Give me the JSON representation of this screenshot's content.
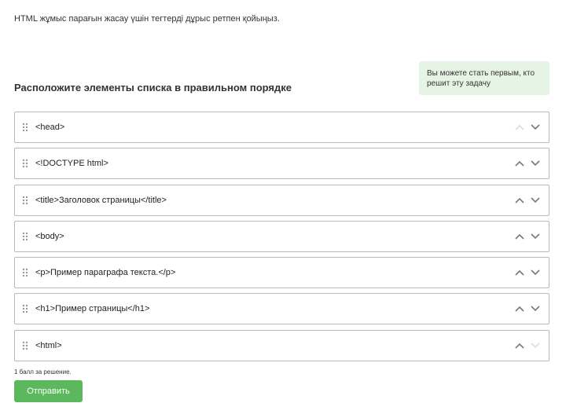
{
  "instruction": "HTML жұмыс парағын жасау үшін тегтерді дұрыс ретпен қойыңыз.",
  "hint": "Вы можете стать первым, кто решит эту задачу",
  "task_title": "Расположите элементы списка в правильном порядке",
  "items": [
    {
      "label": "<head>",
      "up_enabled": false,
      "down_enabled": true
    },
    {
      "label": "<!DOCTYPE html>",
      "up_enabled": true,
      "down_enabled": true
    },
    {
      "label": "<title>Заголовок страницы</title>",
      "up_enabled": true,
      "down_enabled": true
    },
    {
      "label": "<body>",
      "up_enabled": true,
      "down_enabled": true
    },
    {
      "label": "<p>Пример параграфа текста.</p>",
      "up_enabled": true,
      "down_enabled": true
    },
    {
      "label": "<h1>Пример страницы</h1>",
      "up_enabled": true,
      "down_enabled": true
    },
    {
      "label": "<html>",
      "up_enabled": true,
      "down_enabled": false
    }
  ],
  "points_text": "1 балл за решение.",
  "submit_label": "Отправить",
  "colors": {
    "submit": "#5cb85c",
    "hint_bg": "#e6f4e6",
    "border": "#b9b9b9"
  },
  "icons": {
    "handle": "drag-handle-icon",
    "up": "chevron-up-icon",
    "down": "chevron-down-icon"
  }
}
